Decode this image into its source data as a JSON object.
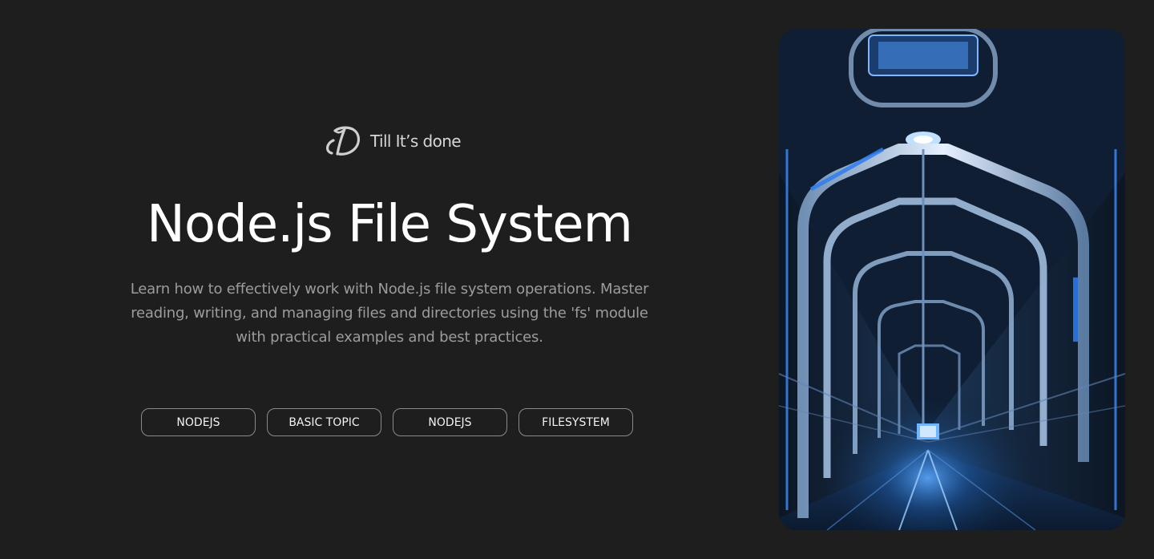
{
  "brand": {
    "name": "Till It’s done",
    "logo_icon": "td-monogram-icon"
  },
  "hero": {
    "title": "Node.js File System",
    "description": "Learn how to effectively work with Node.js file system operations. Master reading, writing, and managing files and directories using the 'fs' module with practical examples and best practices."
  },
  "tags": [
    {
      "label": "NODEJS"
    },
    {
      "label": "BASIC TOPIC"
    },
    {
      "label": "NODEJS"
    },
    {
      "label": "FILESYSTEM"
    }
  ],
  "image": {
    "subject": "futuristic-corridor-image"
  },
  "colors": {
    "background": "#1e1e1e",
    "title": "#ffffff",
    "text_muted": "#9c9c9c",
    "tag_border": "#8a8a8a",
    "accent_blue": "#3b8cff"
  }
}
